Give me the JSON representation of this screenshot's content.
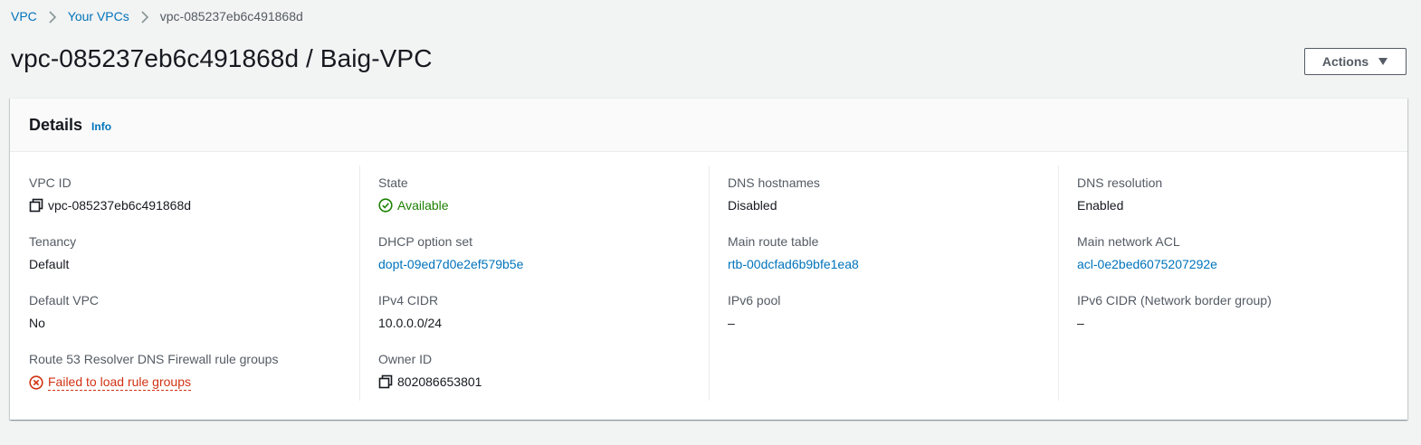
{
  "breadcrumb": {
    "items": [
      "VPC",
      "Your VPCs"
    ],
    "current": "vpc-085237eb6c491868d"
  },
  "page": {
    "title": "vpc-085237eb6c491868d / Baig-VPC",
    "actions_label": "Actions"
  },
  "details": {
    "header": "Details",
    "info_link": "Info",
    "vpc_id": {
      "label": "VPC ID",
      "value": "vpc-085237eb6c491868d"
    },
    "tenancy": {
      "label": "Tenancy",
      "value": "Default"
    },
    "default_vpc": {
      "label": "Default VPC",
      "value": "No"
    },
    "route53": {
      "label": "Route 53 Resolver DNS Firewall rule groups",
      "value": "Failed to load rule groups"
    },
    "state": {
      "label": "State",
      "value": "Available"
    },
    "dhcp": {
      "label": "DHCP option set",
      "value": "dopt-09ed7d0e2ef579b5e"
    },
    "ipv4_cidr": {
      "label": "IPv4 CIDR",
      "value": "10.0.0.0/24"
    },
    "owner_id": {
      "label": "Owner ID",
      "value": "802086653801"
    },
    "dns_hostnames": {
      "label": "DNS hostnames",
      "value": "Disabled"
    },
    "main_route_table": {
      "label": "Main route table",
      "value": "rtb-00dcfad6b9bfe1ea8"
    },
    "ipv6_pool": {
      "label": "IPv6 pool",
      "value": "–"
    },
    "dns_resolution": {
      "label": "DNS resolution",
      "value": "Enabled"
    },
    "main_network_acl": {
      "label": "Main network ACL",
      "value": "acl-0e2bed6075207292e"
    },
    "ipv6_cidr": {
      "label": "IPv6 CIDR (Network border group)",
      "value": "–"
    }
  },
  "colors": {
    "link": "#0073bb",
    "success": "#1d8102",
    "error": "#d13212",
    "background": "#f2f3f3"
  }
}
